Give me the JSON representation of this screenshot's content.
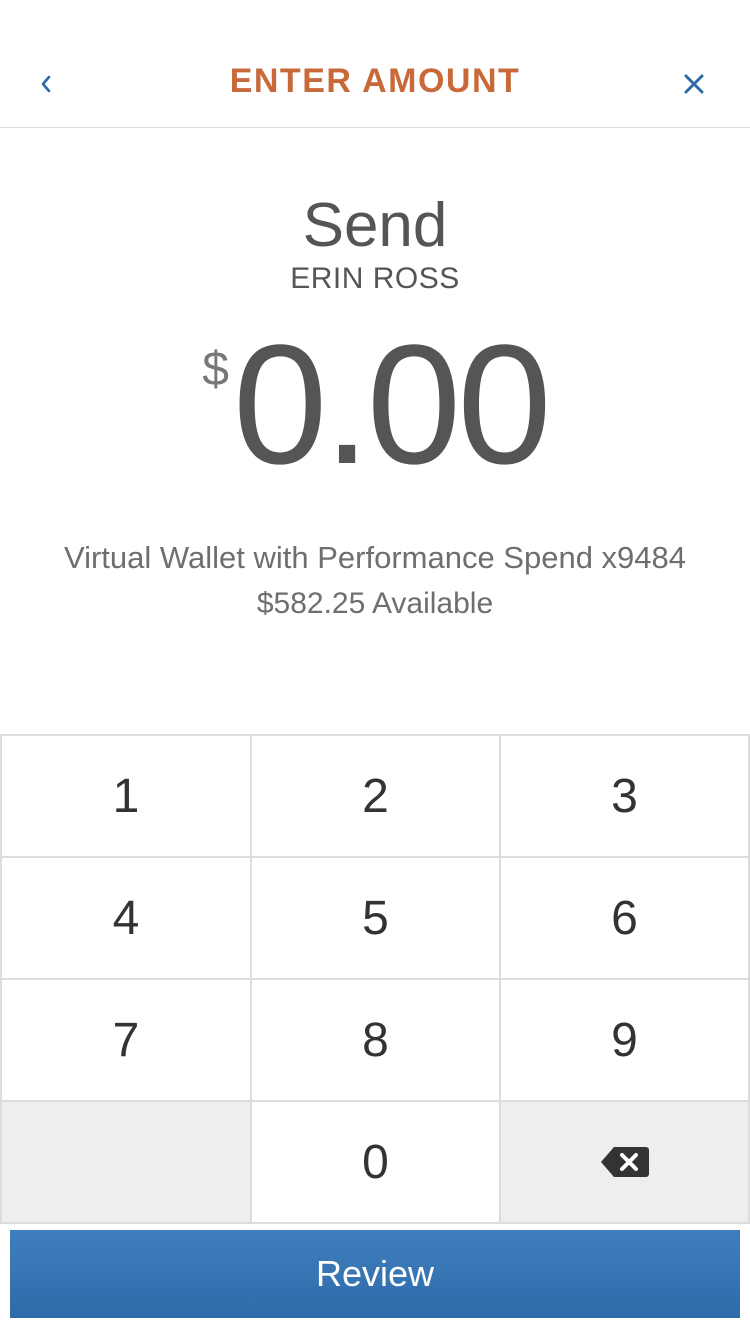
{
  "header": {
    "title": "ENTER AMOUNT",
    "back_icon": "chevron-left-icon",
    "close_icon": "close-icon",
    "accent_color": "#c8693a",
    "icon_color": "#2f6aa8"
  },
  "transfer": {
    "action": "Send",
    "recipient": "ERIN ROSS",
    "currency_symbol": "$",
    "amount": "0.00"
  },
  "account": {
    "name": "Virtual Wallet with Performance Spend x9484",
    "available": "$582.25 Available"
  },
  "keypad": {
    "keys": [
      "1",
      "2",
      "3",
      "4",
      "5",
      "6",
      "7",
      "8",
      "9",
      "0"
    ],
    "backspace_icon": "backspace-icon"
  },
  "footer": {
    "review_label": "Review",
    "button_color": "#3576b4"
  }
}
